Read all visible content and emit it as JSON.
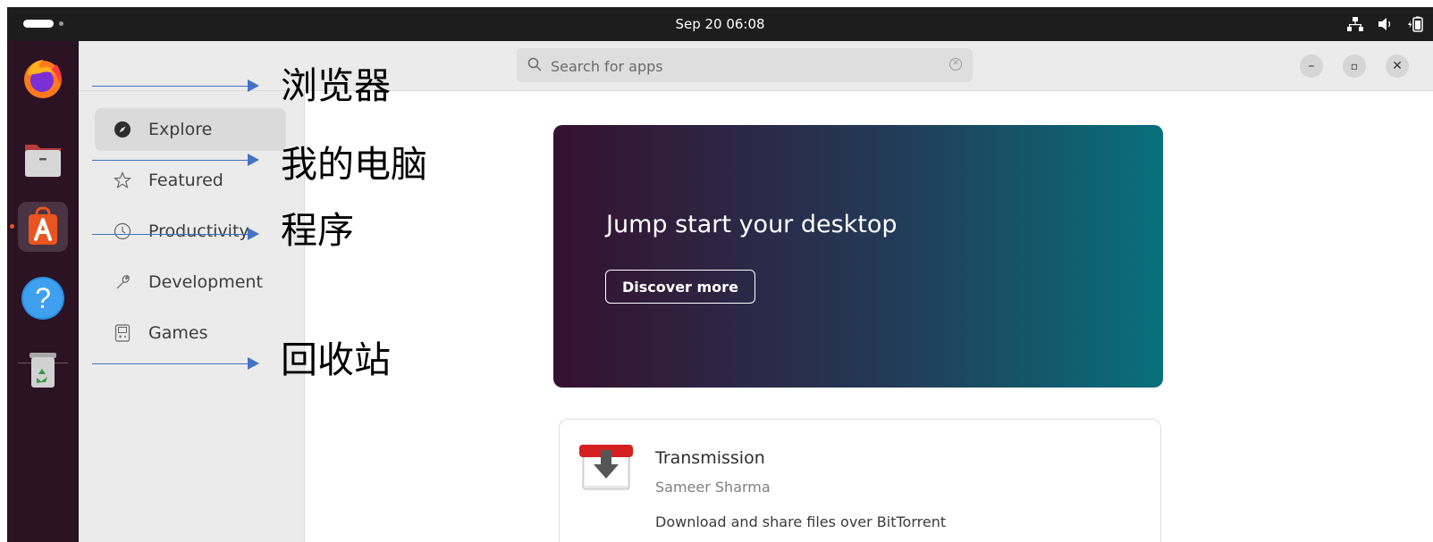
{
  "topbar": {
    "clock": "Sep 20  06:08",
    "tray_icons": [
      "network-icon",
      "volume-icon",
      "battery-icon"
    ]
  },
  "dock": {
    "items": [
      {
        "name": "firefox",
        "icon": "firefox-icon"
      },
      {
        "name": "files",
        "icon": "folder-icon"
      },
      {
        "name": "app-center",
        "icon": "app-center-icon",
        "active": true
      },
      {
        "name": "help",
        "icon": "help-icon"
      },
      {
        "name": "trash",
        "icon": "trash-icon"
      }
    ]
  },
  "window": {
    "search": {
      "placeholder": "Search for apps",
      "value": ""
    },
    "controls": {
      "minimize": "–",
      "restore": "▫",
      "close": "✕"
    }
  },
  "sidebar": {
    "items": [
      {
        "label": "Explore",
        "icon": "compass-icon",
        "selected": true
      },
      {
        "label": "Featured",
        "icon": "star-icon"
      },
      {
        "label": "Productivity",
        "icon": "clock-icon"
      },
      {
        "label": "Development",
        "icon": "wrench-icon"
      },
      {
        "label": "Games",
        "icon": "gameboy-icon"
      }
    ]
  },
  "banner": {
    "title": "Jump start your desktop",
    "button": "Discover more"
  },
  "app_card": {
    "name": "Transmission",
    "author": "Sameer Sharma",
    "description": "Download and share files over BitTorrent",
    "icon": "transmission-icon"
  },
  "annotations": [
    {
      "text": "浏览器"
    },
    {
      "text": "我的电脑"
    },
    {
      "text": "程序"
    },
    {
      "text": "回收站"
    }
  ],
  "colors": {
    "dock_bg": "#2b1323",
    "topbar_bg": "#1d1d1d",
    "accent": "#e95420",
    "annotation_arrow": "#4472c4"
  }
}
